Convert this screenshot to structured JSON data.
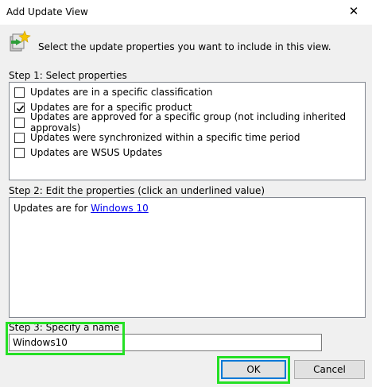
{
  "window": {
    "title": "Add Update View",
    "close_symbol": "✕"
  },
  "intro_text": "Select the update properties you want to include in this view.",
  "step1": {
    "label": "Step 1: Select properties",
    "options": [
      {
        "label": "Updates are in a specific classification",
        "checked": false
      },
      {
        "label": "Updates are for a specific product",
        "checked": true
      },
      {
        "label": "Updates are approved for a specific group (not including inherited approvals)",
        "checked": false
      },
      {
        "label": "Updates were synchronized within a specific time period",
        "checked": false
      },
      {
        "label": "Updates are WSUS Updates",
        "checked": false
      }
    ]
  },
  "step2": {
    "label": "Step 2: Edit the properties (click an underlined value)",
    "text_prefix": "Updates are for",
    "link_value": "Windows 10"
  },
  "step3": {
    "label": "Step 3: Specify a name",
    "name_value": "Windows10"
  },
  "buttons": {
    "ok": "OK",
    "cancel": "Cancel"
  },
  "colors": {
    "highlight": "#25e025",
    "link": "#0000ee",
    "focus_border": "#0078d7"
  }
}
